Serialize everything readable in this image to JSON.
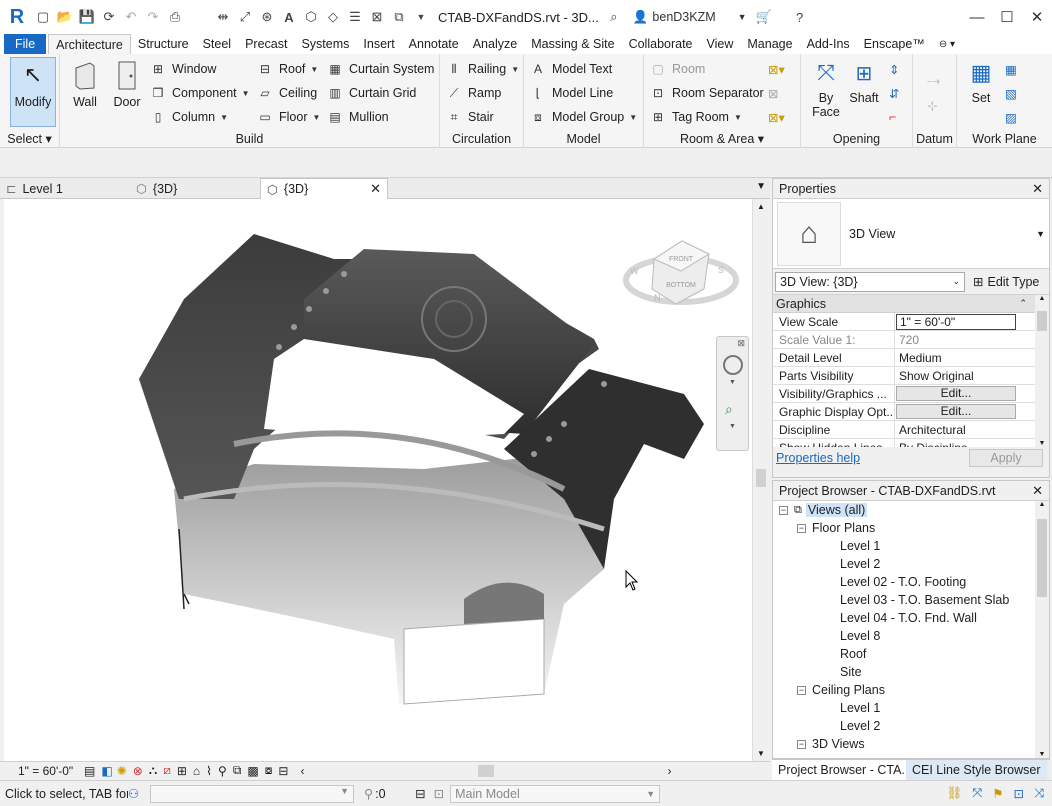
{
  "titlebar": {
    "title": "CTAB-DXFandDS.rvt - 3D...",
    "username": "benD3KZM"
  },
  "ribbon_tabs": [
    "File",
    "Architecture",
    "Structure",
    "Steel",
    "Precast",
    "Systems",
    "Insert",
    "Annotate",
    "Analyze",
    "Massing & Site",
    "Collaborate",
    "View",
    "Manage",
    "Add-Ins",
    "Enscape™"
  ],
  "ribbon": {
    "select": {
      "modify": "Modify",
      "label": "Select"
    },
    "build": {
      "wall": "Wall",
      "door": "Door",
      "window": "Window",
      "component": "Component",
      "column": "Column",
      "roof": "Roof",
      "ceiling": "Ceiling",
      "floor": "Floor",
      "curtain_system": "Curtain System",
      "curtain_grid": "Curtain Grid",
      "mullion": "Mullion",
      "label": "Build"
    },
    "circulation": {
      "railing": "Railing",
      "ramp": "Ramp",
      "stair": "Stair",
      "label": "Circulation"
    },
    "model": {
      "text": "Model Text",
      "line": "Model Line",
      "group": "Model Group",
      "label": "Model"
    },
    "room": {
      "room": "Room",
      "separator": "Room Separator",
      "tag": "Tag Room",
      "label": "Room & Area"
    },
    "opening": {
      "byface": "By Face",
      "shaft": "Shaft",
      "label": "Opening"
    },
    "datum": {
      "label": "Datum"
    },
    "workplane": {
      "set": "Set",
      "label": "Work Plane"
    }
  },
  "view_tabs": [
    {
      "label": "Level 1"
    },
    {
      "label": "{3D}"
    },
    {
      "label": "{3D}"
    }
  ],
  "viewcube": {
    "front": "FRONT",
    "bottom": "BOTTOM",
    "compass": [
      "W",
      "S",
      "N"
    ]
  },
  "properties": {
    "title": "Properties",
    "type": "3D View",
    "selector": "3D View: {3D}",
    "edit_type": "Edit Type",
    "section": "Graphics",
    "rows": [
      {
        "key": "View Scale",
        "value": "1\" = 60'-0\""
      },
      {
        "key": "Scale Value    1:",
        "value": "720"
      },
      {
        "key": "Detail Level",
        "value": "Medium"
      },
      {
        "key": "Parts Visibility",
        "value": "Show Original"
      },
      {
        "key": "Visibility/Graphics ...",
        "value": "Edit..."
      },
      {
        "key": "Graphic Display Opt...",
        "value": "Edit..."
      },
      {
        "key": "Discipline",
        "value": "Architectural"
      },
      {
        "key": "Show Hidden Lines",
        "value": "By Discipline"
      }
    ],
    "help": "Properties help",
    "apply": "Apply"
  },
  "project_browser": {
    "title": "Project Browser - CTAB-DXFandDS.rvt",
    "root": "Views (all)",
    "floor_plans": "Floor Plans",
    "floor_items": [
      "Level 1",
      "Level 2",
      "Level 02 - T.O. Footing",
      "Level 03 - T.O. Basement Slab",
      "Level 04 - T.O. Fnd. Wall",
      "Level 8",
      "Roof",
      "Site"
    ],
    "ceiling_plans": "Ceiling Plans",
    "ceiling_items": [
      "Level 1",
      "Level 2"
    ],
    "views_3d": "3D Views"
  },
  "bottom_tabs": [
    "Project Browser - CTA...",
    "CEI Line Style Browser"
  ],
  "view_control": {
    "scale": "1\" = 60'-0\""
  },
  "status": {
    "text": "Click to select, TAB for a",
    "coord": ":0",
    "model": "Main Model"
  },
  "colors": {
    "accent": "#1769c4",
    "ribbon": "#f5f5f5"
  }
}
